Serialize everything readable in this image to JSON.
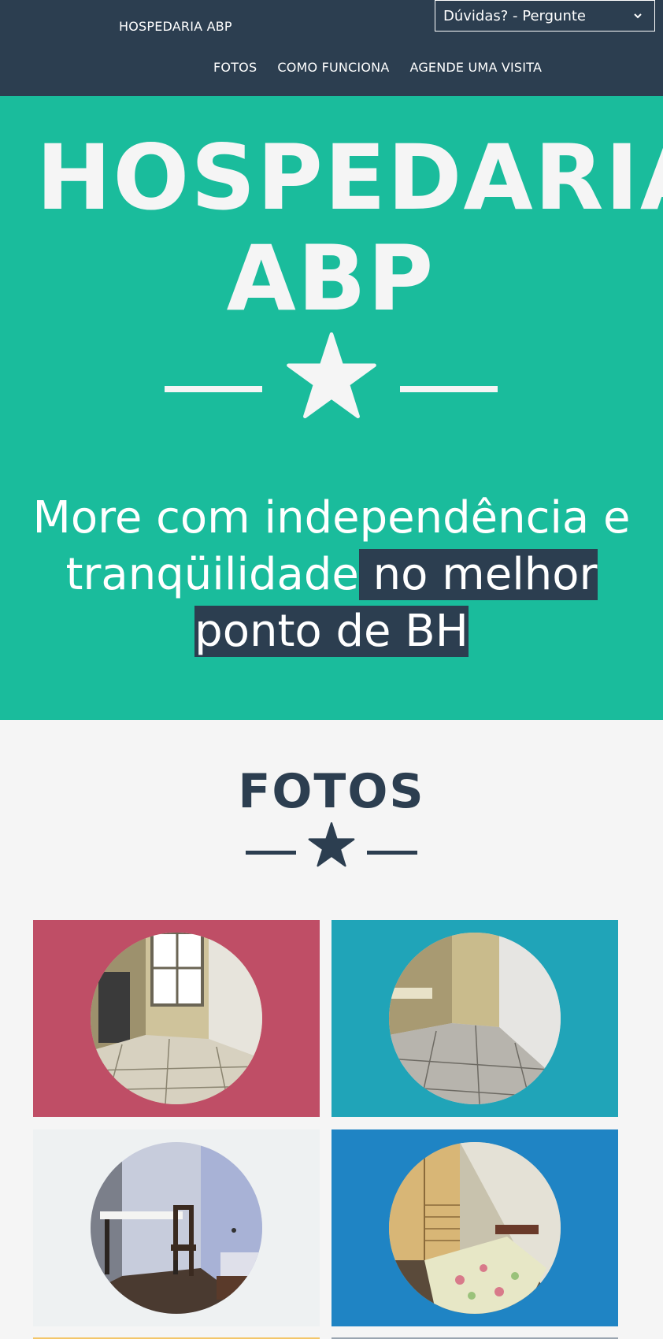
{
  "navbar": {
    "brand": "HOSPEDARIA ABP",
    "ask_select": "Dúvidas? - Pergunte",
    "links": [
      "FOTOS",
      "COMO FUNCIONA",
      "AGENDE UMA VISITA"
    ]
  },
  "hero": {
    "title_line1": "HOSPEDARIA",
    "title_line2": "ABP",
    "tagline_plain": "More com independência e tranqüilidade",
    "tagline_highlight_1": " no melhor",
    "tagline_highlight_2": "ponto de BH"
  },
  "fotos": {
    "title": "FOTOS",
    "photos": [
      {
        "subject": "empty-room-window"
      },
      {
        "subject": "corridor-sink"
      },
      {
        "subject": "desk-chair"
      },
      {
        "subject": "bed-wardrobe"
      }
    ]
  },
  "colors": {
    "navbar": "#2c3e50",
    "hero": "#1abc9c",
    "card1": "#bf4e66",
    "card2": "#20a4b8",
    "card3": "#eef1f2",
    "card4": "#1f84c4"
  }
}
